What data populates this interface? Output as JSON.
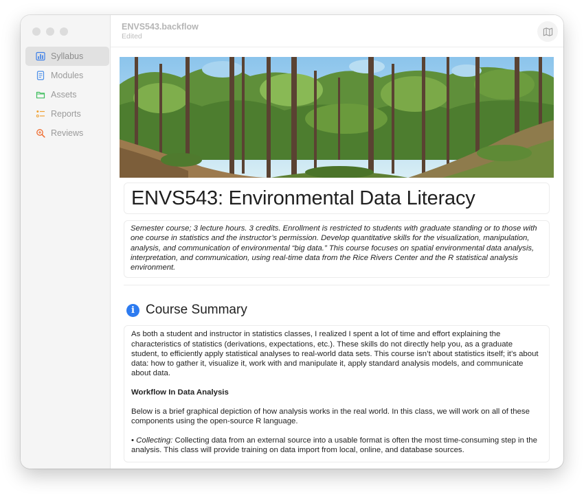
{
  "app": {
    "doc_title": "ENVS543.backflow",
    "doc_status": "Edited"
  },
  "sidebar": {
    "items": [
      {
        "label": "Syllabus",
        "icon": "chart-bar-icon",
        "color": "#3b7ee8",
        "active": true
      },
      {
        "label": "Modules",
        "icon": "document-icon",
        "color": "#4a8ee8",
        "active": false
      },
      {
        "label": "Assets",
        "icon": "folder-icon",
        "color": "#3dbd5c",
        "active": false
      },
      {
        "label": "Reports",
        "icon": "list-icon",
        "color": "#f0a030",
        "active": false
      },
      {
        "label": "Reviews",
        "icon": "magnifier-icon",
        "color": "#ef6b2e",
        "active": false
      }
    ]
  },
  "toolbar": {
    "map_icon": "map-icon"
  },
  "page": {
    "title": "ENVS543: Environmental Data Literacy",
    "description": "Semester course; 3 lecture hours. 3 credits. Enrollment is restricted to students with graduate standing or to those with one course in statistics and the instructor’s permission. Develop quantitative skills for the visualization, manipulation, analysis, and communication of environmental “big data.” This course focuses on spatial environmental data analysis, interpretation, and communication, using real-time data from the Rice Rivers Center and the R statistical analysis environment.",
    "section_title": "Course Summary",
    "section_icon": "info-icon",
    "summary": "As both a student and instructor in statistics classes, I realized I spent a lot of time and effort explaining the characteristics of statistics (derivations, expectations, etc.). These skills do not directly help you, as a graduate student, to efficiently apply statistical analyses to real-world data sets. This course isn’t about statistics itself; it’s about data: how to gather it, visualize it, work with and manipulate it, apply standard analysis models, and communicate about data.",
    "workflow_heading": "Workflow In Data Analysis",
    "workflow_text": "Below is a brief graphical depiction of how analysis works in the real world. In this class, we will work on all of these components using the open-source R language.",
    "bullet_label": "Collecting:",
    "bullet_text": " Collecting data from an external source into a usable format is often the most time-consuming step in the analysis. This class will provide training on data import from local, online, and database sources."
  }
}
